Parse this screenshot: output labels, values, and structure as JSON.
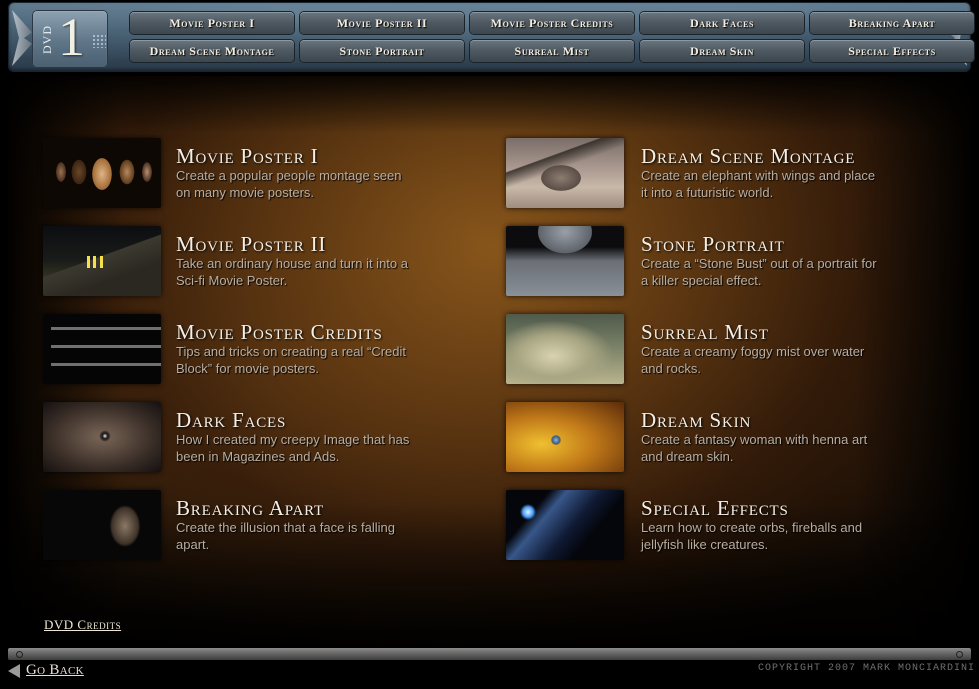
{
  "header": {
    "dvd_label": "DVD",
    "dvd_number": "1",
    "nav_buttons": [
      {
        "label": "Movie Poster I"
      },
      {
        "label": "Movie Poster II"
      },
      {
        "label": "Movie Poster Credits"
      },
      {
        "label": "Dark Faces"
      },
      {
        "label": "Breaking Apart"
      },
      {
        "label": "Dream Scene Montage"
      },
      {
        "label": "Stone Portrait"
      },
      {
        "label": "Surreal Mist"
      },
      {
        "label": "Dream Skin"
      },
      {
        "label": "Special Effects"
      }
    ]
  },
  "tutorials": {
    "left": [
      {
        "title": "Movie Poster I",
        "description": "Create a popular people montage seen on many movie posters.",
        "thumbnail": "faces-montage"
      },
      {
        "title": "Movie Poster II",
        "description": "Take an ordinary house and turn it into a Sci-fi Movie Poster.",
        "thumbnail": "night-house"
      },
      {
        "title": "Movie Poster Credits",
        "description": "Tips and tricks on creating a real “Credit Block” for movie posters.",
        "thumbnail": "credit-block"
      },
      {
        "title": "Dark Faces",
        "description": "How I created my creepy Image that has been in Magazines and Ads.",
        "thumbnail": "creepy-eye"
      },
      {
        "title": "Breaking Apart",
        "description": "Create the illusion that a face is falling apart.",
        "thumbnail": "breaking-face"
      }
    ],
    "right": [
      {
        "title": "Dream Scene Montage",
        "description": "Create an elephant with wings and place it into a futuristic world.",
        "thumbnail": "winged-elephant"
      },
      {
        "title": "Stone Portrait",
        "description": "Create a “Stone Bust” out of a portrait for a killer special effect.",
        "thumbnail": "stone-bust"
      },
      {
        "title": "Surreal Mist",
        "description": "Create a creamy foggy mist over water and rocks.",
        "thumbnail": "misty-rocks"
      },
      {
        "title": "Dream Skin",
        "description": "Create a fantasy woman with henna art and dream skin.",
        "thumbnail": "henna-eye"
      },
      {
        "title": "Special Effects",
        "description": "Learn how to create orbs, fireballs and jellyfish like creatures.",
        "thumbnail": "blue-orb"
      }
    ]
  },
  "footer": {
    "dvd_credits": "DVD Credits",
    "go_back": "Go Back",
    "copyright": "COPYRIGHT 2007 MARK MONCIARDINI"
  }
}
